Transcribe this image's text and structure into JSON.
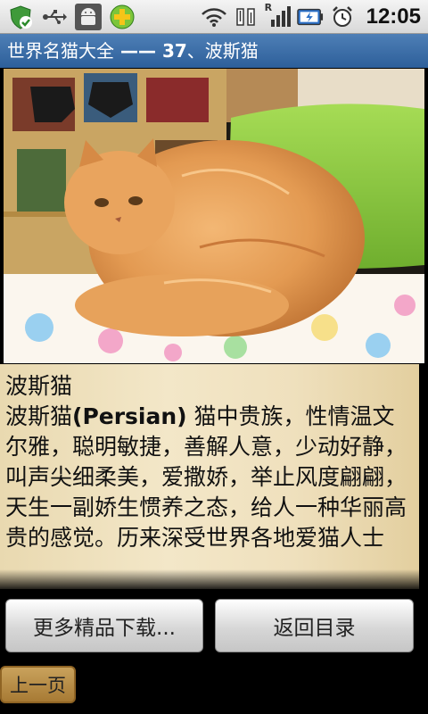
{
  "status_bar": {
    "time": "12:05",
    "icons": [
      "shield-check-icon",
      "usb-icon",
      "android-debug-icon",
      "plus-app-icon",
      "wifi-icon",
      "data-arrows-icon",
      "signal-icon",
      "battery-charging-icon",
      "alarm-icon"
    ],
    "roaming_letter": "R"
  },
  "title_bar": {
    "app_name": "世界名猫大全",
    "separator": " —— ",
    "number": "37",
    "suffix": "、波斯猫"
  },
  "photo": {
    "subject": "orange persian cat on cushion"
  },
  "article": {
    "heading": "波斯猫",
    "name": "波斯猫",
    "english": "(Persian)",
    "body": " 猫中贵族，性情温文尔雅，聪明敏捷，善解人意，少动好静，叫声尖细柔美，爱撒娇，举止风度翩翩，天生一副娇生惯养之态，给人一种华丽高贵的感觉。历来深受世界各地爱猫人士"
  },
  "buttons": {
    "more": "更多精品下载...",
    "back": "返回目录",
    "prev": "上一页"
  },
  "colors": {
    "title_bar": "#3a6ea8",
    "text_bg": "#f0e2c0",
    "prev_button": "#b68a45"
  }
}
